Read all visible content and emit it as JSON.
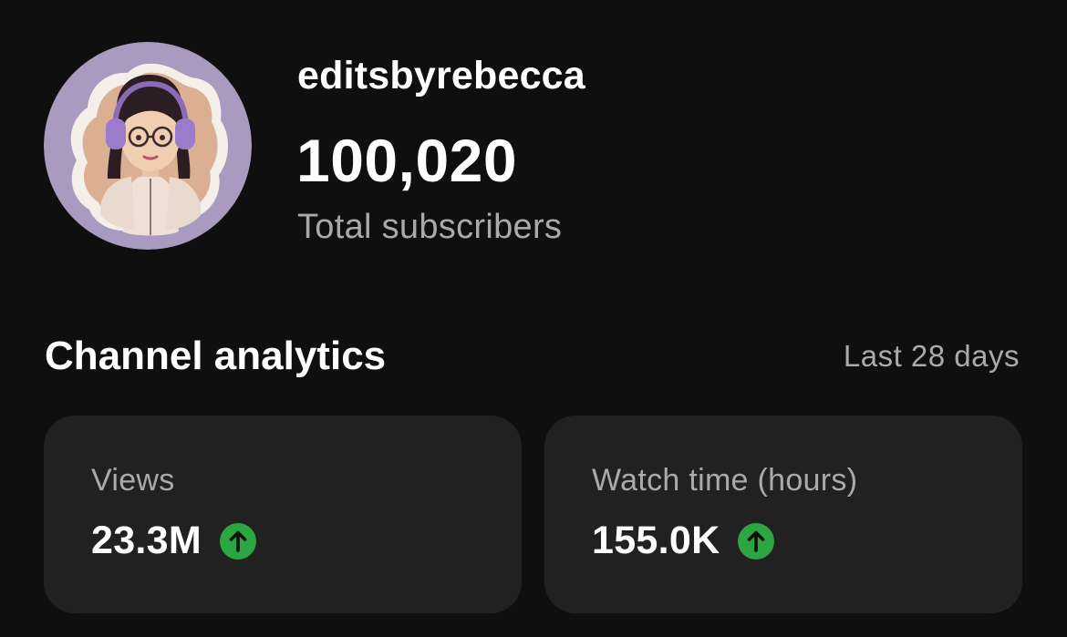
{
  "channel": {
    "name": "editsbyrebecca",
    "subscriber_count": "100,020",
    "subscriber_label": "Total subscribers",
    "avatar_icon": "cartoon-avatar-with-headphones"
  },
  "analytics": {
    "title": "Channel analytics",
    "period": "Last 28 days",
    "cards": [
      {
        "label": "Views",
        "value": "23.3M",
        "trend": "up",
        "trend_icon": "arrow-up-icon"
      },
      {
        "label": "Watch time (hours)",
        "value": "155.0K",
        "trend": "up",
        "trend_icon": "arrow-up-icon"
      }
    ]
  },
  "colors": {
    "background": "#0f0f0f",
    "card": "#212121",
    "secondary_text": "#aaaaaa",
    "trend_up": "#2ba640",
    "avatar_ring": "#a99bbf"
  }
}
